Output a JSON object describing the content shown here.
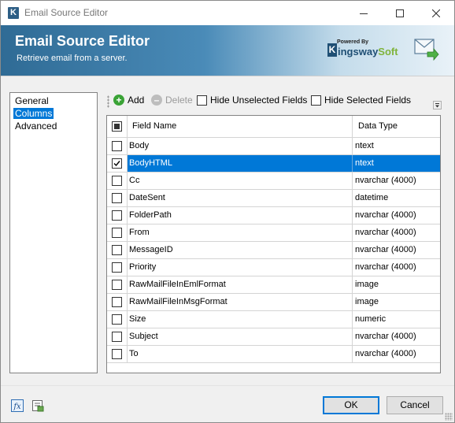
{
  "window": {
    "title": "Email Source Editor",
    "controls": [
      "minimize-icon",
      "maximize-icon",
      "close-icon"
    ]
  },
  "banner": {
    "title": "Email Source Editor",
    "subtitle": "Retrieve email from a server.",
    "logo_powered": "Powered By",
    "logo_k": "K",
    "logo_name_main": "ingsway",
    "logo_name_accent": "Soft",
    "icon": "mail-arrow-icon"
  },
  "nav": {
    "items": [
      {
        "label": "General",
        "selected": false
      },
      {
        "label": "Columns",
        "selected": true
      },
      {
        "label": "Advanced",
        "selected": false
      }
    ]
  },
  "toolbar": {
    "add_label": "Add",
    "delete_label": "Delete",
    "hide_unselected_label": "Hide Unselected Fields",
    "hide_selected_label": "Hide Selected Fields",
    "hide_unselected_checked": false,
    "hide_selected_checked": false
  },
  "grid": {
    "columns": [
      "Field Name",
      "Data Type"
    ],
    "header_checkbox_state": "indeterminate",
    "rows": [
      {
        "field": "Body",
        "type": "ntext",
        "checked": false,
        "selected": false
      },
      {
        "field": "BodyHTML",
        "type": "ntext",
        "checked": true,
        "selected": true
      },
      {
        "field": "Cc",
        "type": "nvarchar (4000)",
        "checked": false,
        "selected": false
      },
      {
        "field": "DateSent",
        "type": "datetime",
        "checked": false,
        "selected": false
      },
      {
        "field": "FolderPath",
        "type": "nvarchar (4000)",
        "checked": false,
        "selected": false
      },
      {
        "field": "From",
        "type": "nvarchar (4000)",
        "checked": false,
        "selected": false
      },
      {
        "field": "MessageID",
        "type": "nvarchar (4000)",
        "checked": false,
        "selected": false
      },
      {
        "field": "Priority",
        "type": "nvarchar (4000)",
        "checked": false,
        "selected": false
      },
      {
        "field": "RawMailFileInEmlFormat",
        "type": "image",
        "checked": false,
        "selected": false
      },
      {
        "field": "RawMailFileInMsgFormat",
        "type": "image",
        "checked": false,
        "selected": false
      },
      {
        "field": "Size",
        "type": "numeric",
        "checked": false,
        "selected": false
      },
      {
        "field": "Subject",
        "type": "nvarchar (4000)",
        "checked": false,
        "selected": false
      },
      {
        "field": "To",
        "type": "nvarchar (4000)",
        "checked": false,
        "selected": false
      }
    ]
  },
  "footer": {
    "ok_label": "OK",
    "cancel_label": "Cancel",
    "icons": [
      "expression-fx-icon",
      "variables-icon"
    ]
  },
  "colors": {
    "selection": "#0078d7",
    "banner_dark": "#2f6b95",
    "add_green": "#3aa336",
    "brand_blue": "#1f4f74",
    "brand_green": "#7fb33a"
  }
}
